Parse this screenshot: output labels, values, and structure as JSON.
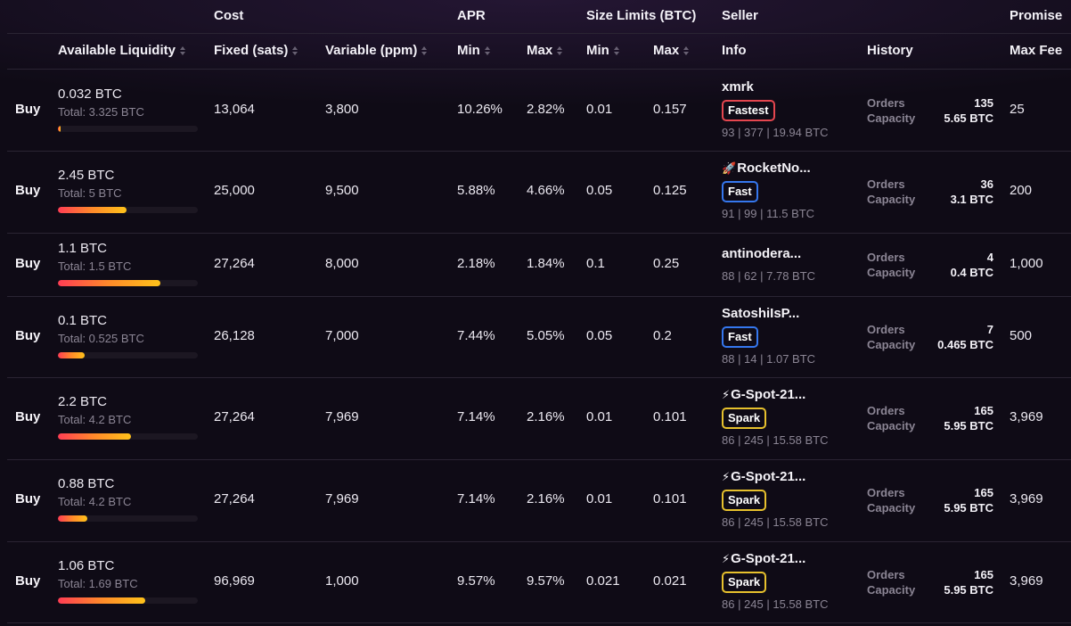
{
  "header": {
    "groups": {
      "cost": "Cost",
      "apr": "APR",
      "size_limits": "Size Limits (BTC)",
      "seller": "Seller",
      "promise": "Promise"
    },
    "columns": {
      "available_liquidity": "Available Liquidity",
      "fixed": "Fixed (sats)",
      "variable": "Variable (ppm)",
      "apr_min": "Min",
      "apr_max": "Max",
      "size_min": "Min",
      "size_max": "Max",
      "info": "Info",
      "history": "History",
      "max_fee": "Max Fee"
    }
  },
  "history_labels": {
    "orders": "Orders",
    "capacity": "Capacity"
  },
  "rows": [
    {
      "buy": "Buy",
      "liquidity": "0.032 BTC",
      "total": "Total: 3.325 BTC",
      "fill_fraction": 0.01,
      "fixed": "13,064",
      "variable": "3,800",
      "apr_min": "10.26%",
      "apr_max": "2.82%",
      "size_min": "0.01",
      "size_max": "0.157",
      "seller_icon": "",
      "seller_name": "xmrk",
      "badge": "Fastest",
      "badge_color": "#e5464f",
      "stats": "93 | 377 | 19.94 BTC",
      "orders": "135",
      "capacity": "5.65 BTC",
      "max_fee": "25"
    },
    {
      "buy": "Buy",
      "liquidity": "2.45 BTC",
      "total": "Total: 5 BTC",
      "fill_fraction": 0.49,
      "fixed": "25,000",
      "variable": "9,500",
      "apr_min": "5.88%",
      "apr_max": "4.66%",
      "size_min": "0.05",
      "size_max": "0.125",
      "seller_icon": "rocket-icon",
      "seller_name": "RocketNo...",
      "badge": "Fast",
      "badge_color": "#3577ee",
      "stats": "91 | 99 | 11.5 BTC",
      "orders": "36",
      "capacity": "3.1 BTC",
      "max_fee": "200"
    },
    {
      "buy": "Buy",
      "liquidity": "1.1 BTC",
      "total": "Total: 1.5 BTC",
      "fill_fraction": 0.733,
      "fixed": "27,264",
      "variable": "8,000",
      "apr_min": "2.18%",
      "apr_max": "1.84%",
      "size_min": "0.1",
      "size_max": "0.25",
      "seller_icon": "",
      "seller_name": "antinodera...",
      "badge": "",
      "badge_color": "",
      "stats": "88 | 62 | 7.78 BTC",
      "orders": "4",
      "capacity": "0.4 BTC",
      "max_fee": "1,000"
    },
    {
      "buy": "Buy",
      "liquidity": "0.1 BTC",
      "total": "Total: 0.525 BTC",
      "fill_fraction": 0.19,
      "fixed": "26,128",
      "variable": "7,000",
      "apr_min": "7.44%",
      "apr_max": "5.05%",
      "size_min": "0.05",
      "size_max": "0.2",
      "seller_icon": "",
      "seller_name": "SatoshiIsP...",
      "badge": "Fast",
      "badge_color": "#3577ee",
      "stats": "88 | 14 | 1.07 BTC",
      "orders": "7",
      "capacity": "0.465 BTC",
      "max_fee": "500"
    },
    {
      "buy": "Buy",
      "liquidity": "2.2 BTC",
      "total": "Total: 4.2 BTC",
      "fill_fraction": 0.524,
      "fixed": "27,264",
      "variable": "7,969",
      "apr_min": "7.14%",
      "apr_max": "2.16%",
      "size_min": "0.01",
      "size_max": "0.101",
      "seller_icon": "lightning-icon",
      "seller_name": "G-Spot-21...",
      "badge": "Spark",
      "badge_color": "#e7c12d",
      "stats": "86 | 245 | 15.58 BTC",
      "orders": "165",
      "capacity": "5.95 BTC",
      "max_fee": "3,969"
    },
    {
      "buy": "Buy",
      "liquidity": "0.88 BTC",
      "total": "Total: 4.2 BTC",
      "fill_fraction": 0.21,
      "fixed": "27,264",
      "variable": "7,969",
      "apr_min": "7.14%",
      "apr_max": "2.16%",
      "size_min": "0.01",
      "size_max": "0.101",
      "seller_icon": "lightning-icon",
      "seller_name": "G-Spot-21...",
      "badge": "Spark",
      "badge_color": "#e7c12d",
      "stats": "86 | 245 | 15.58 BTC",
      "orders": "165",
      "capacity": "5.95 BTC",
      "max_fee": "3,969"
    },
    {
      "buy": "Buy",
      "liquidity": "1.06 BTC",
      "total": "Total: 1.69 BTC",
      "fill_fraction": 0.627,
      "fixed": "96,969",
      "variable": "1,000",
      "apr_min": "9.57%",
      "apr_max": "9.57%",
      "size_min": "0.021",
      "size_max": "0.021",
      "seller_icon": "lightning-icon",
      "seller_name": "G-Spot-21...",
      "badge": "Spark",
      "badge_color": "#e7c12d",
      "stats": "86 | 245 | 15.58 BTC",
      "orders": "165",
      "capacity": "5.95 BTC",
      "max_fee": "3,969"
    }
  ]
}
